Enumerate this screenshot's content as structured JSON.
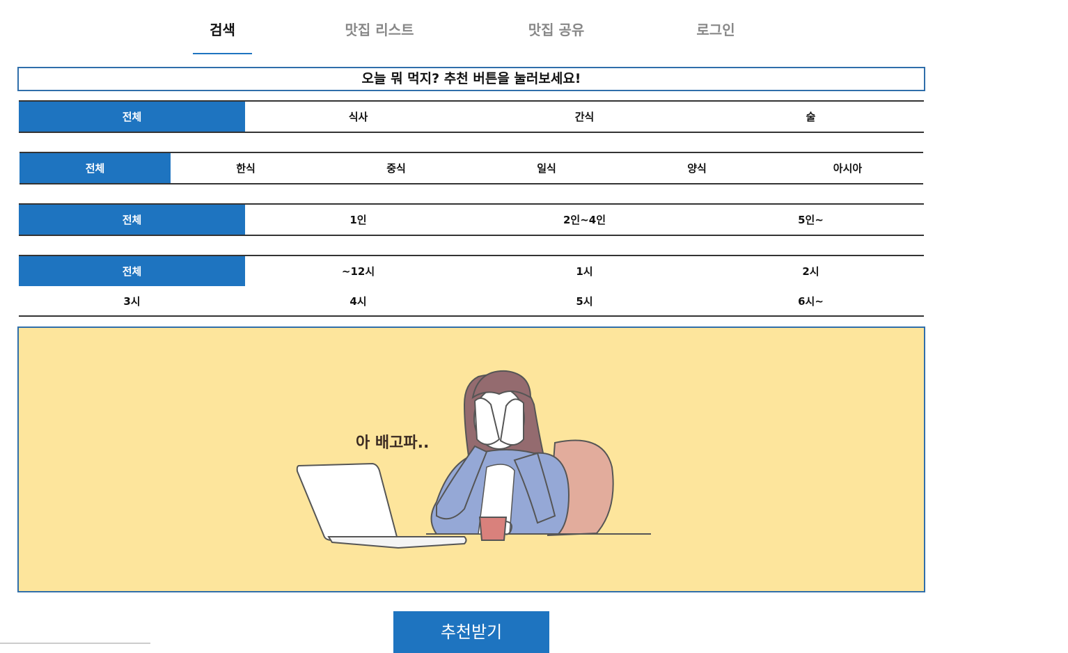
{
  "nav": {
    "tabs": [
      {
        "label": "검색",
        "active": true
      },
      {
        "label": "맛집 리스트",
        "active": false
      },
      {
        "label": "맛집 공유",
        "active": false
      },
      {
        "label": "로그인",
        "active": false
      }
    ]
  },
  "headline": "오늘 뭐 먹지? 추천 버튼을 눌러보세요!",
  "filters": {
    "type": [
      "전체",
      "식사",
      "간식",
      "술"
    ],
    "cuisine": [
      "전체",
      "한식",
      "중식",
      "일식",
      "양식",
      "아시아"
    ],
    "people": [
      "전체",
      "1인",
      "2인~4인",
      "5인~"
    ],
    "time": [
      "전체",
      "~12시",
      "1시",
      "2시",
      "3시",
      "4시",
      "5시",
      "6시~"
    ]
  },
  "banner": {
    "caption": "아 배고파.."
  },
  "recommend_button": "추천받기",
  "colors": {
    "accent": "#1e74c0",
    "banner_bg": "#fde59c",
    "border": "#2f6eaa"
  }
}
